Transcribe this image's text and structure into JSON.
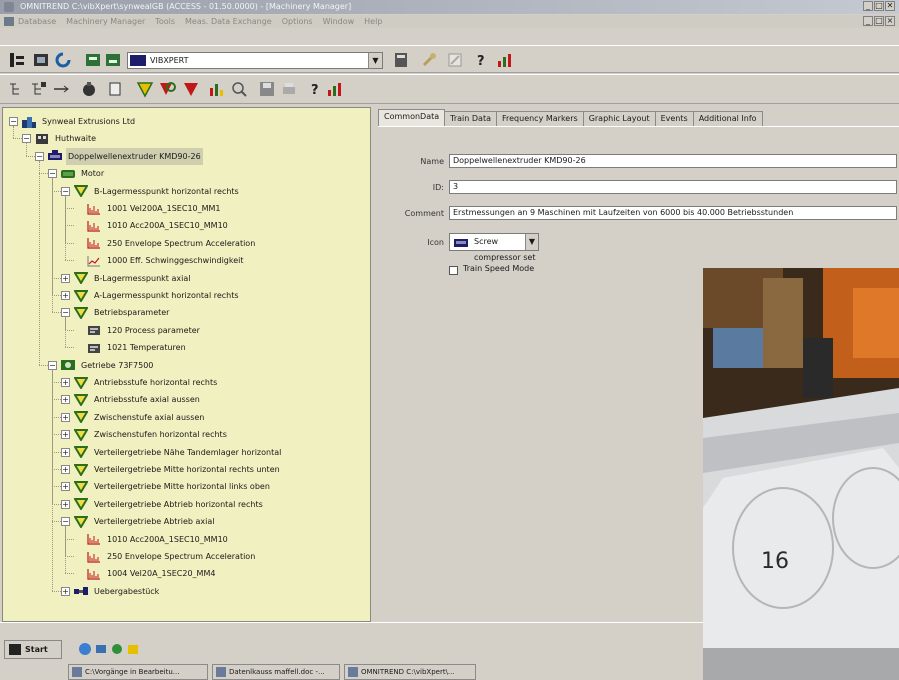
{
  "window": {
    "title": "OMNITREND C:\\vibXpert\\synwealGB (ACCESS - 01.50.0000) - [Machinery Manager]",
    "controls": [
      "_",
      "×",
      "✕"
    ]
  },
  "menu": {
    "items": [
      "Database",
      "Machinery Manager",
      "Tools",
      "Meas. Data Exchange",
      "Options",
      "Window",
      "Help"
    ]
  },
  "toolbar": {
    "device_combo": "VIBXPERT",
    "dropdown_glyph": "▼"
  },
  "tree": {
    "nodes": [
      {
        "label": "Synweal Extrusions Ltd",
        "icon": "company-icon",
        "exp": "−"
      },
      {
        "label": "Huthwaite",
        "icon": "site-icon",
        "exp": "−"
      },
      {
        "label": "Doppelwellenextruder KMD90-26",
        "icon": "machine-icon",
        "exp": "−"
      },
      {
        "label": "Motor",
        "icon": "motor-icon",
        "exp": "−"
      },
      {
        "label": "B-Lagermesspunkt horizontal rechts",
        "icon": "measpoint-icon",
        "exp": "−"
      },
      {
        "label": "1001 Vel200A_1SEC10_MM1",
        "icon": "spectrum-icon"
      },
      {
        "label": "1010 Acc200A_1SEC10_MM10",
        "icon": "spectrum-icon"
      },
      {
        "label": "250 Envelope Spectrum Acceleration",
        "icon": "spectrum-icon"
      },
      {
        "label": "1000 Eff. Schwinggeschwindigkeit",
        "icon": "trend-icon"
      },
      {
        "label": "B-Lagermesspunkt axial",
        "icon": "measpoint-icon",
        "exp": "+"
      },
      {
        "label": "A-Lagermesspunkt horizontal rechts",
        "icon": "measpoint-icon",
        "exp": "+"
      },
      {
        "label": "Betriebsparameter",
        "icon": "measpoint-icon",
        "exp": "−"
      },
      {
        "label": "120 Process parameter",
        "icon": "process-icon"
      },
      {
        "label": "1021 Temperaturen",
        "icon": "process-icon"
      },
      {
        "label": "Getriebe 73F7500",
        "icon": "gearbox-icon",
        "exp": "−"
      },
      {
        "label": "Antriebsstufe horizontal rechts",
        "icon": "measpoint-icon",
        "exp": "+"
      },
      {
        "label": "Antriebsstufe axial aussen",
        "icon": "measpoint-icon",
        "exp": "+"
      },
      {
        "label": "Zwischenstufe axial aussen",
        "icon": "measpoint-icon",
        "exp": "+"
      },
      {
        "label": "Zwischenstufen horizontal rechts",
        "icon": "measpoint-icon",
        "exp": "+"
      },
      {
        "label": "Verteilergetriebe Nähe Tandemlager horizontal",
        "icon": "measpoint-icon",
        "exp": "+"
      },
      {
        "label": "Verteilergetriebe Mitte horizontal rechts unten",
        "icon": "measpoint-icon",
        "exp": "+"
      },
      {
        "label": "Verteilergetriebe Mitte horizontal links oben",
        "icon": "measpoint-icon",
        "exp": "+"
      },
      {
        "label": "Verteilergetriebe Abtrieb horizontal rechts",
        "icon": "measpoint-icon",
        "exp": "+"
      },
      {
        "label": "Verteilergetriebe Abtrieb axial",
        "icon": "measpoint-icon",
        "exp": "−"
      },
      {
        "label": "1010 Acc200A_1SEC10_MM10",
        "icon": "spectrum-icon"
      },
      {
        "label": "250 Envelope Spectrum Acceleration",
        "icon": "spectrum-icon"
      },
      {
        "label": "1004 Vel20A_1SEC20_MM4",
        "icon": "spectrum-icon"
      },
      {
        "label": "Uebergabestück",
        "icon": "coupling-icon",
        "exp": "+"
      }
    ]
  },
  "tabs": [
    "CommonData",
    "Train Data",
    "Frequency Markers",
    "Graphic Layout",
    "Events",
    "Additional Info"
  ],
  "form": {
    "name_label": "Name",
    "name_value": "Doppelwellenextruder KMD90-26",
    "id_label": "ID:",
    "id_value": "3",
    "comment_label": "Comment",
    "comment_value": "Erstmessungen an 9 Maschinen mit Laufzeiten von 6000 bis 40.000 Betriebsstunden",
    "icon_label": "Icon",
    "icon_value": "Screw compressor set",
    "train_speed_label": "Train Speed Mode"
  },
  "photo": {
    "handwritten_number": "16"
  },
  "taskbar": {
    "start_label": "Start",
    "tasks": [
      "C:\\Vorgänge in Bearbeitu...",
      "Datenlkauss maffell.doc -...",
      "OMNITREND C:\\vibXpert\\..."
    ]
  },
  "colors": {
    "tree_bg": "#f1f0c0",
    "panel_bg": "#d4d0c8",
    "icon_green": "#2b6f1e",
    "icon_red": "#c01818"
  }
}
